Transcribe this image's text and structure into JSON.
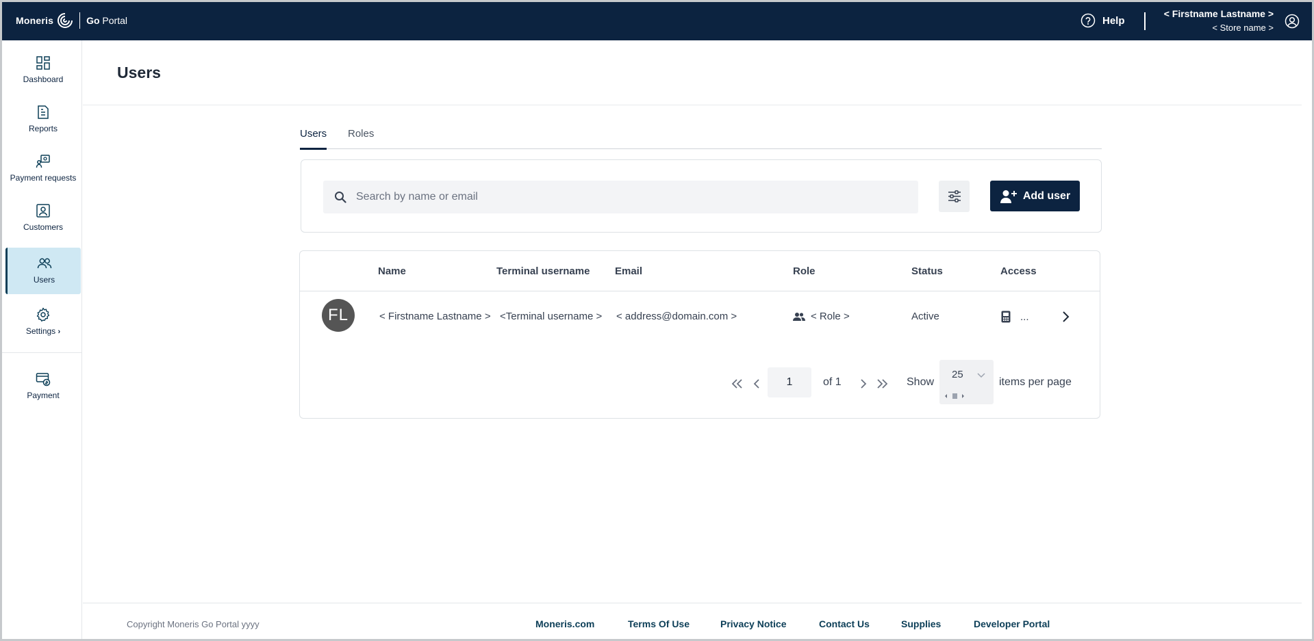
{
  "header": {
    "brand_name": "Moneris",
    "product_prefix": "Go",
    "product_suffix": "Portal",
    "help_label": "Help",
    "user_name": "< Firstname Lastname >",
    "store_name": "< Store name >",
    "background_color": "#0c2340"
  },
  "sidebar": {
    "items": [
      {
        "label": "Dashboard",
        "icon": "dashboard-icon"
      },
      {
        "label": "Reports",
        "icon": "reports-icon"
      },
      {
        "label": "Payment requests",
        "icon": "payment-requests-icon"
      },
      {
        "label": "Customers",
        "icon": "customers-icon"
      },
      {
        "label": "Users",
        "icon": "users-icon",
        "active": true
      },
      {
        "label": "Settings",
        "icon": "gear-icon"
      },
      {
        "label": "Payment",
        "icon": "payment-icon"
      }
    ],
    "active_color": "#cfe8f3"
  },
  "page": {
    "title": "Users"
  },
  "tabs": [
    {
      "label": "Users",
      "active": true
    },
    {
      "label": "Roles",
      "active": false
    }
  ],
  "search": {
    "placeholder": "Search by name or email",
    "value": ""
  },
  "actions": {
    "add_user_label": "Add user"
  },
  "table": {
    "columns": [
      "Name",
      "Terminal username",
      "Email",
      "Role",
      "Status",
      "Access"
    ],
    "rows": [
      {
        "initials": "FL",
        "name": "< Firstname Lastname >",
        "terminal_username": "<Terminal username >",
        "email": "< address@domain.com >",
        "role": "< Role >",
        "status": "Active",
        "access": "..."
      }
    ]
  },
  "pagination": {
    "current_page": "1",
    "of_label": "of 1",
    "show_label": "Show",
    "per_page": "25",
    "items_per_page_label": "items per page"
  },
  "footer": {
    "copyright": "Copyright Moneris Go Portal  yyyy",
    "links": [
      "Moneris.com",
      "Terms Of Use",
      "Privacy Notice",
      "Contact Us",
      "Supplies",
      "Developer Portal"
    ]
  }
}
